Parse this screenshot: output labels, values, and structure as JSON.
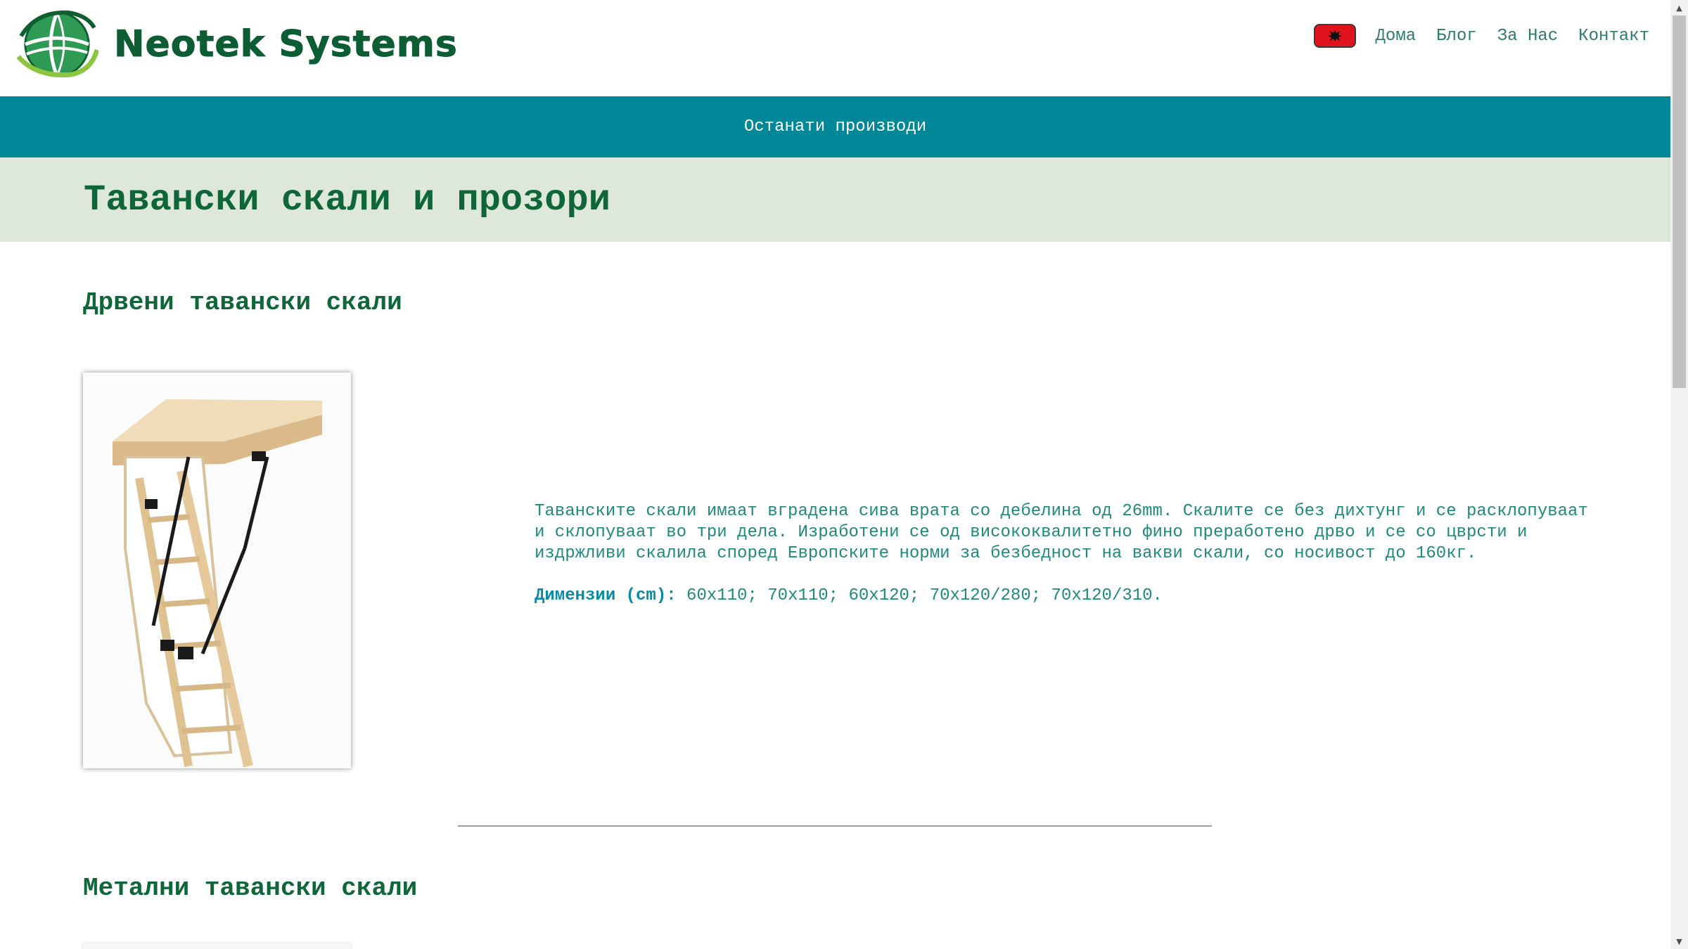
{
  "header": {
    "logo_text": "Neotek Systems",
    "nav": {
      "home": "Дома",
      "blog": "Блог",
      "about": "За Нас",
      "contact": "Контакт"
    }
  },
  "subnav": {
    "label": "Останати производи"
  },
  "page": {
    "title": "Тавански скали и прозори"
  },
  "sections": [
    {
      "title": "Дрвени тавански скали",
      "image_alt": "wooden attic ladder",
      "description": "Таванските скали имаат вградена сива врата со дебелина од 26mm. Скалите се без дихтунг и се расклопуваат и склопуваат во три дела. Изработени се од висококвалитетно фино преработено дрво и се со цврсти и издржливи скалила според Европските норми за безбедност на вакви скали, со носивост до 160кг.",
      "dims_label": "Димензии (cm):",
      "dims_value": " 60x110; 70x110; 60x120; 70x120/280; 70x120/310."
    },
    {
      "title": "Метални тавански скали"
    }
  ],
  "colors": {
    "brand_green": "#0f6638",
    "teal_bar": "#008898",
    "title_band": "#dde8da",
    "text_teal": "#1f8a79",
    "dims_label": "#0a8aa5",
    "flag_red": "#e0121b"
  },
  "icons": {
    "flag": "albanian-flag-icon",
    "logo": "globe-logo-icon",
    "scroll_up": "scroll-up-arrow-icon",
    "scroll_down": "scroll-down-arrow-icon"
  }
}
